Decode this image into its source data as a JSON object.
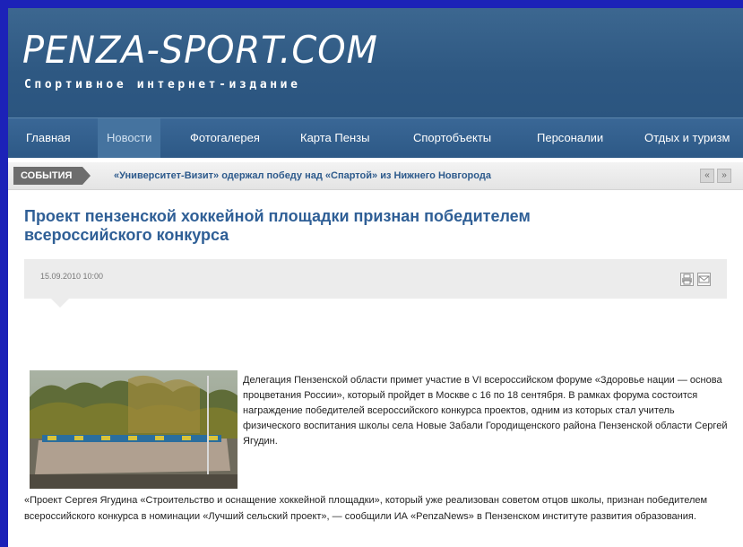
{
  "site": {
    "logo_title": "PENZA-SPORT.COM",
    "logo_subtitle": "Спортивное интернет-издание"
  },
  "nav": {
    "items": [
      {
        "label": "Главная"
      },
      {
        "label": "Новости",
        "active": true
      },
      {
        "label": "Фотогалерея"
      },
      {
        "label": "Карта Пензы"
      },
      {
        "label": "Спортобъекты"
      },
      {
        "label": "Персоналии"
      },
      {
        "label": "Отдых и туризм"
      }
    ]
  },
  "ticker": {
    "label": "СОБЫТИЯ",
    "text": "«Университет-Визит» одержал победу над «Спартой» из Нижнего Новгорода",
    "prev": "«",
    "next": "»"
  },
  "article": {
    "title": "Проект пензенской хоккейной площадки признан победителем всероссийского конкурса",
    "date": "15.09.2010 10:00",
    "intro": "Делегация Пензенской области примет участие в VI всероссийском форуме «Здоровье нации — основа процветания России», который пройдет в Москве с 16 по 18 сентября. В рамках форума состоится награждение победителей всероссийского конкурса проектов, одним из которых стал учитель физического воспитания школы села Новые Забали Городищенского района Пензенской области Сергей Ягудин.",
    "body": "«Проект Сергея Ягудина «Строительство и оснащение хоккейной площадки», который уже реализован советом отцов школы, признан победителем всероссийского конкурса в номинации «Лучший сельский проект», — сообщили ИА «PenzaNews» в Пензенском институте развития образования."
  },
  "colors": {
    "slide_background": "#1c22b8",
    "header": "#2e5882",
    "title": "#2f5f96",
    "ticker_link": "#2d5a8c"
  },
  "icons": [
    "print-icon",
    "email-icon"
  ]
}
